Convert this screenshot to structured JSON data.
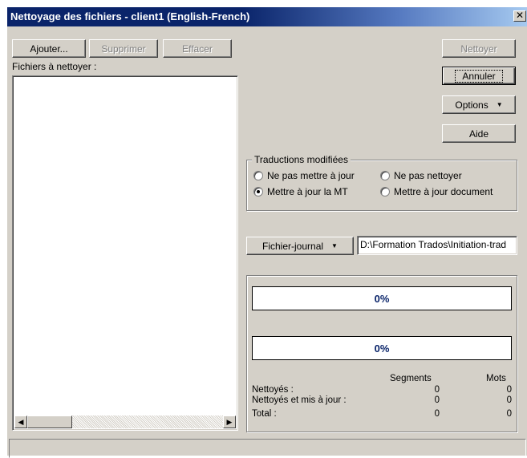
{
  "window": {
    "title": "Nettoyage des fichiers - client1  (English-French)",
    "close_glyph": "✕"
  },
  "toolbar": {
    "add_label": "Ajouter...",
    "remove_label": "Supprimer",
    "clear_label": "Effacer"
  },
  "files": {
    "label": "Fichiers à nettoyer :",
    "items": []
  },
  "actions": {
    "clean_label": "Nettoyer",
    "cancel_label": "Annuler",
    "options_label": "Options",
    "help_label": "Aide"
  },
  "translations": {
    "legend": "Traductions modifiées",
    "options": [
      {
        "label": "Ne pas mettre à jour",
        "selected": false
      },
      {
        "label": "Ne pas nettoyer",
        "selected": false
      },
      {
        "label": "Mettre à jour la MT",
        "selected": true
      },
      {
        "label": "Mettre à jour document",
        "selected": false
      }
    ]
  },
  "logfile": {
    "button_label": "Fichier-journal",
    "path": "D:\\Formation Trados\\Initiation-trad"
  },
  "progress": {
    "bar1_text": "0%",
    "bar1_value": 0,
    "bar2_text": "0%",
    "bar2_value": 0
  },
  "stats": {
    "col_segments": "Segments",
    "col_words": "Mots",
    "rows": [
      {
        "label": "Nettoyés :",
        "segments": "0",
        "words": "0"
      },
      {
        "label": "Nettoyés et mis à jour :",
        "segments": "0",
        "words": "0"
      },
      {
        "label": "Total :",
        "segments": "0",
        "words": "0"
      }
    ]
  },
  "status": {
    "text": ""
  }
}
